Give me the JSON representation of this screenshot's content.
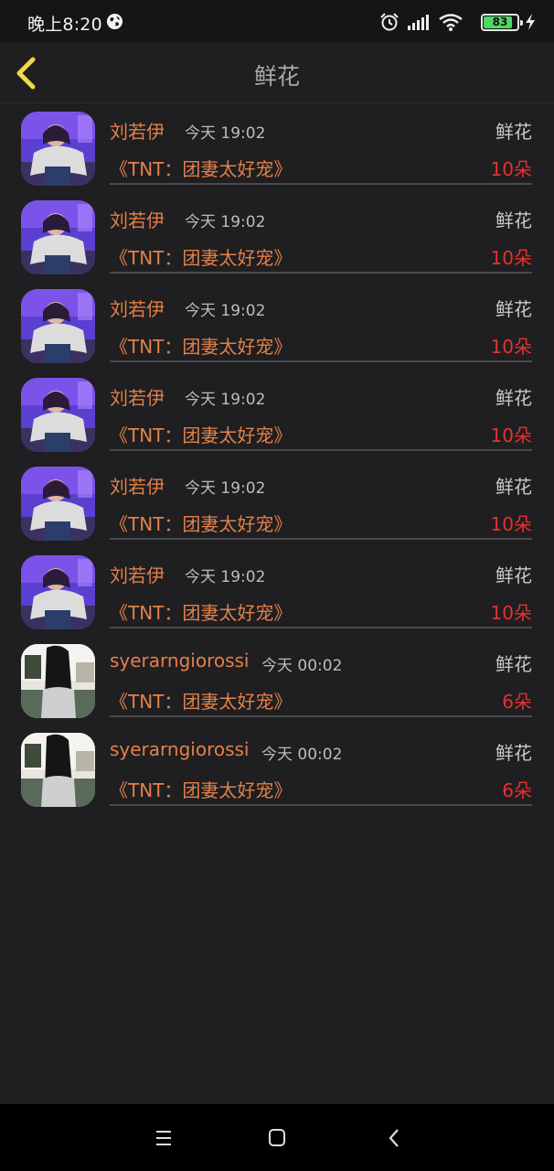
{
  "status_bar": {
    "time": "晚上8:20",
    "battery": "83",
    "icons": [
      "globe-icon",
      "alarm-icon",
      "signal-icon",
      "wifi-icon",
      "battery-icon",
      "charging-icon"
    ]
  },
  "header": {
    "title": "鲜花",
    "back_icon": "chevron-left-icon"
  },
  "items": [
    {
      "name": "刘若伊",
      "time": "今天 19:02",
      "gift": "鲜花",
      "show": "《TNT：团妻太好宠》",
      "count": "10朵",
      "avatar": "avatar-a"
    },
    {
      "name": "刘若伊",
      "time": "今天 19:02",
      "gift": "鲜花",
      "show": "《TNT：团妻太好宠》",
      "count": "10朵",
      "avatar": "avatar-a"
    },
    {
      "name": "刘若伊",
      "time": "今天 19:02",
      "gift": "鲜花",
      "show": "《TNT：团妻太好宠》",
      "count": "10朵",
      "avatar": "avatar-a"
    },
    {
      "name": "刘若伊",
      "time": "今天 19:02",
      "gift": "鲜花",
      "show": "《TNT：团妻太好宠》",
      "count": "10朵",
      "avatar": "avatar-a"
    },
    {
      "name": "刘若伊",
      "time": "今天 19:02",
      "gift": "鲜花",
      "show": "《TNT：团妻太好宠》",
      "count": "10朵",
      "avatar": "avatar-a"
    },
    {
      "name": "刘若伊",
      "time": "今天 19:02",
      "gift": "鲜花",
      "show": "《TNT：团妻太好宠》",
      "count": "10朵",
      "avatar": "avatar-a"
    },
    {
      "name": "syerarngiorossi",
      "time": "今天 00:02",
      "gift": "鲜花",
      "show": "《TNT：团妻太好宠》",
      "count": "6朵",
      "avatar": "avatar-b"
    },
    {
      "name": "syerarngiorossi",
      "time": "今天 00:02",
      "gift": "鲜花",
      "show": "《TNT：团妻太好宠》",
      "count": "6朵",
      "avatar": "avatar-b"
    }
  ],
  "nav_bar": {
    "icons": [
      "menu-icon",
      "home-square-icon",
      "back-triangle-icon"
    ]
  },
  "colors": {
    "background": "#1f1e20",
    "name": "#e2804a",
    "count": "#e2332f",
    "back_arrow": "#f0d84a"
  }
}
